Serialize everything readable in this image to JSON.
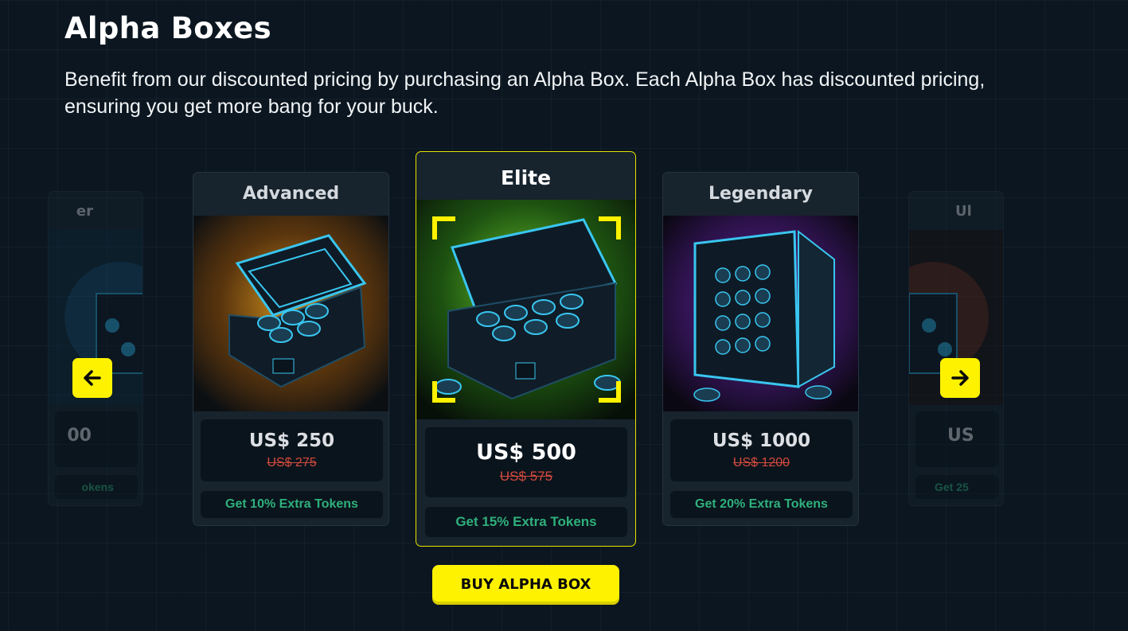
{
  "section": {
    "title": "Alpha Boxes",
    "subtitle": "Benefit from our discounted pricing by purchasing an Alpha Box. Each Alpha Box has discounted pricing, ensuring you get more bang for your buck."
  },
  "cards": {
    "left_partial": {
      "name": "er",
      "price": "00",
      "bonus": "okens",
      "accent": "#2aa8d6"
    },
    "advanced": {
      "name": "Advanced",
      "price": "US$ 250",
      "old_price": "US$ 275",
      "bonus": "Get 10% Extra Tokens",
      "accent": "#f2a51a"
    },
    "elite": {
      "name": "Elite",
      "price": "US$ 500",
      "old_price": "US$ 575",
      "bonus": "Get 15% Extra Tokens",
      "accent": "#5bd61e"
    },
    "legendary": {
      "name": "Legendary",
      "price": "US$ 1000",
      "old_price": "US$ 1200",
      "bonus": "Get 20% Extra Tokens",
      "accent": "#a13ce0"
    },
    "right_partial": {
      "name": "Ul",
      "price": "US",
      "bonus": "Get 25",
      "accent": "#e24a1e"
    }
  },
  "nav": {
    "prev_icon": "arrow-left-icon",
    "next_icon": "arrow-right-icon"
  },
  "buy_button": {
    "label": "BUY ALPHA BOX"
  },
  "colors": {
    "accent_yellow": "#fff200",
    "bonus_green": "#2fb07c",
    "strike_red": "#d24a3d",
    "background": "#0b1620"
  }
}
